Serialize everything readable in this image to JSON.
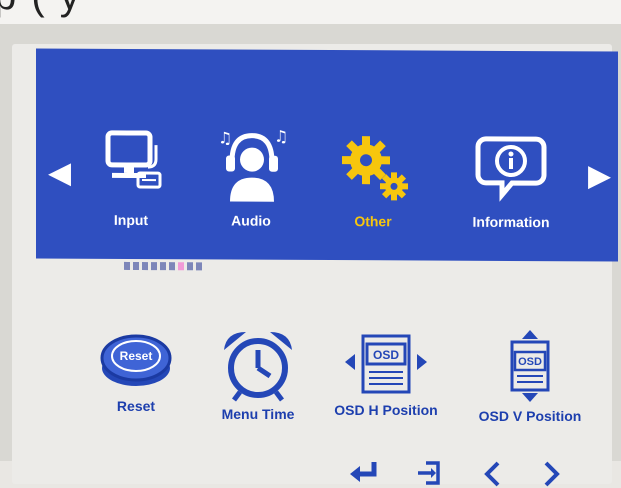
{
  "top_strip_text": "p ( y",
  "nav": {
    "left_arrow": "◀",
    "right_arrow": "▶"
  },
  "tabs": [
    {
      "label": "Input",
      "icon": "monitor-keyboard-icon",
      "active": false
    },
    {
      "label": "Audio",
      "icon": "headphones-person-icon",
      "active": false
    },
    {
      "label": "Other",
      "icon": "gears-icon",
      "active": true
    },
    {
      "label": "Information",
      "icon": "info-bubble-icon",
      "active": false
    }
  ],
  "page_indicator": {
    "count": 9,
    "active_index": 6
  },
  "options": [
    {
      "label": "Reset",
      "icon": "reset-icon",
      "icon_text": "Reset"
    },
    {
      "label": "Menu Time",
      "icon": "alarm-clock-icon"
    },
    {
      "label": "OSD H Position",
      "icon": "osd-h-position-icon",
      "icon_text": "OSD"
    },
    {
      "label": "OSD V Position",
      "icon": "osd-v-position-icon",
      "icon_text": "OSD"
    }
  ],
  "footer_keys": [
    {
      "icon": "enter-icon"
    },
    {
      "icon": "exit-icon"
    },
    {
      "icon": "chevron-left-icon"
    },
    {
      "icon": "chevron-right-icon"
    }
  ],
  "colors": {
    "menu_bg": "#2f4fc0",
    "active_tab": "#f7c60d",
    "option_blue": "#1d3fae",
    "indicator_active": "#f19ad7"
  }
}
